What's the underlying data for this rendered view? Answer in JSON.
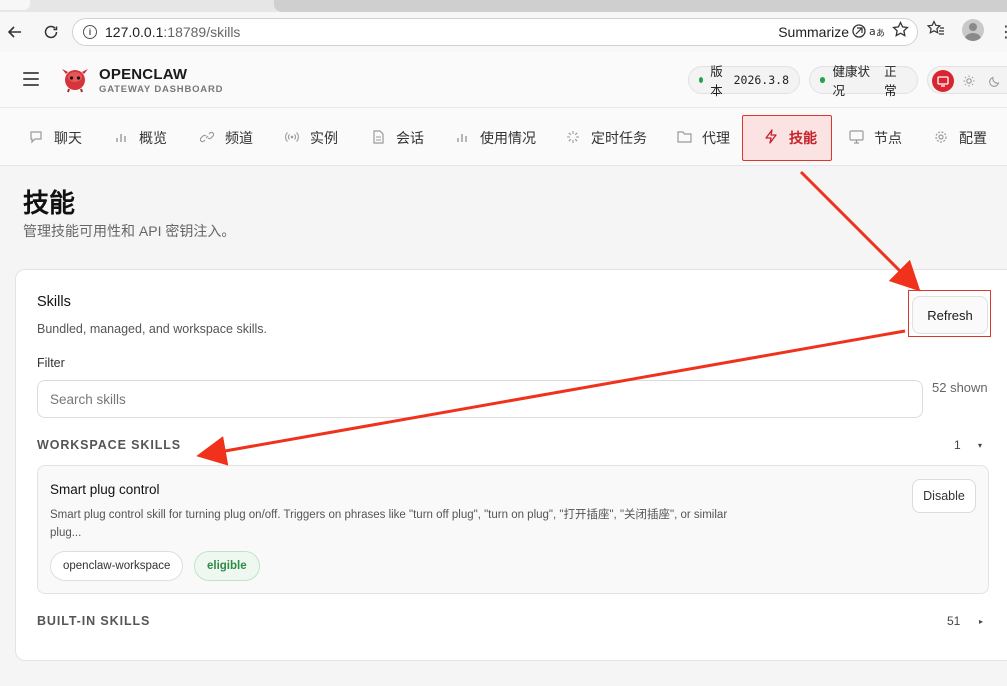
{
  "browser": {
    "url_host": "127.0.0.1",
    "url_rest": ":18789/skills",
    "summarize_label": "Summarize"
  },
  "header": {
    "brand_title": "OPENCLAW",
    "brand_subtitle": "GATEWAY DASHBOARD",
    "version_label": "版本",
    "version_value": "2026.3.8",
    "health_label": "健康状况",
    "health_value": "正常",
    "status_color": "#22a447",
    "accent_color": "#d9252f"
  },
  "nav": {
    "items": [
      {
        "label": "聊天",
        "icon": "chat-icon"
      },
      {
        "label": "概览",
        "icon": "bar-chart-icon"
      },
      {
        "label": "频道",
        "icon": "link-icon"
      },
      {
        "label": "实例",
        "icon": "radio-icon"
      },
      {
        "label": "会话",
        "icon": "document-icon"
      },
      {
        "label": "使用情况",
        "icon": "bar-chart-icon"
      },
      {
        "label": "定时任务",
        "icon": "loader-icon"
      },
      {
        "label": "代理",
        "icon": "folder-icon"
      },
      {
        "label": "技能",
        "icon": "lightning-icon"
      },
      {
        "label": "节点",
        "icon": "monitor-icon"
      },
      {
        "label": "配置",
        "icon": "gear-icon"
      }
    ],
    "active": "技能"
  },
  "page": {
    "title": "技能",
    "subtitle": "管理技能可用性和 API 密钥注入。"
  },
  "skills_card": {
    "title": "Skills",
    "description": "Bundled, managed, and workspace skills.",
    "refresh_label": "Refresh",
    "filter_label": "Filter",
    "search_placeholder": "Search skills",
    "shown_count": "52 shown",
    "workspace_group": {
      "label": "WORKSPACE SKILLS",
      "count": "1",
      "caret": "▾"
    },
    "builtin_group": {
      "label": "BUILT-IN SKILLS",
      "count": "51",
      "caret": "▸"
    },
    "skill": {
      "name": "Smart plug control",
      "description": "Smart plug control skill for turning plug on/off. Triggers on phrases like \"turn off plug\", \"turn on plug\", \"打开插座\", \"关闭插座\", or similar plug...",
      "disable_label": "Disable",
      "tags": [
        "openclaw-workspace",
        "eligible"
      ]
    }
  }
}
